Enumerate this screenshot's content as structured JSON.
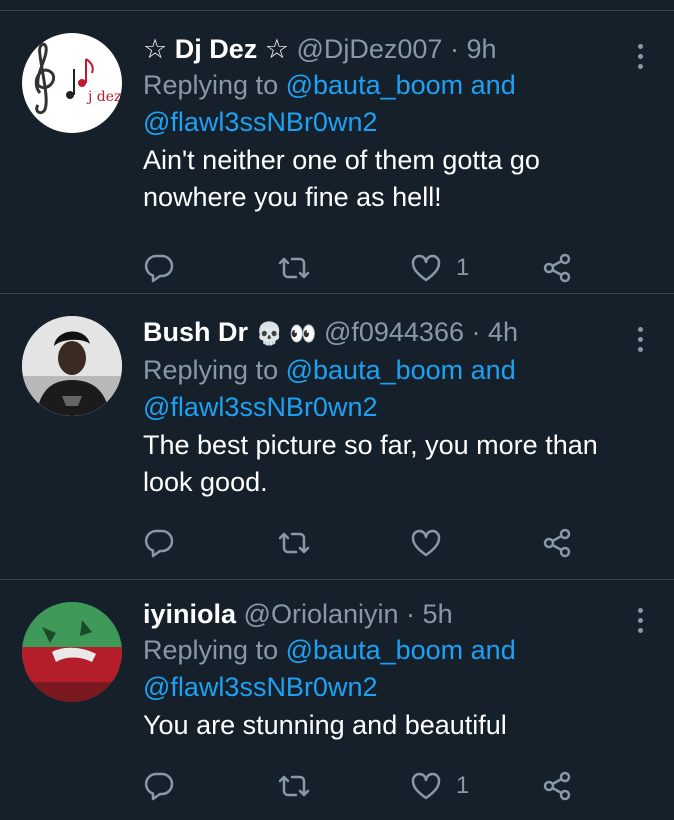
{
  "tweets": [
    {
      "display_name": "☆ Dj Dez ☆",
      "handle": "@DjDez007",
      "separator": "·",
      "time": "9h",
      "replying_prefix": "Replying to",
      "reply_user_1": "@bauta_boom",
      "reply_and": "and",
      "reply_user_2": "@flawl3ssNBr0wn2",
      "text": "Ain't neither one of them gotta go nowhere you fine as hell!",
      "like_count": "1",
      "avatar_logo_text": "j dez"
    },
    {
      "display_name": "Bush Dr",
      "emoji": "💀 👀",
      "handle": "@f0944366",
      "separator": "·",
      "time": "4h",
      "replying_prefix": "Replying to",
      "reply_user_1": "@bauta_boom",
      "reply_and": "and",
      "reply_user_2": "@flawl3ssNBr0wn2",
      "text": "The best picture so far, you more than look good.",
      "like_count": ""
    },
    {
      "display_name": "iyiniola",
      "handle": "@Oriolaniyin",
      "separator": "·",
      "time": "5h",
      "replying_prefix": "Replying to",
      "reply_user_1": "@bauta_boom",
      "reply_and": "and",
      "reply_user_2": "@flawl3ssNBr0wn2",
      "text": "You are stunning and beautiful",
      "like_count": "1"
    }
  ],
  "colors": {
    "background": "#15202b",
    "divider": "#38444d",
    "secondary_text": "#8899a6",
    "link": "#1da1f2"
  },
  "icons": [
    "reply-icon",
    "retweet-icon",
    "like-icon",
    "share-icon",
    "more-icon"
  ]
}
